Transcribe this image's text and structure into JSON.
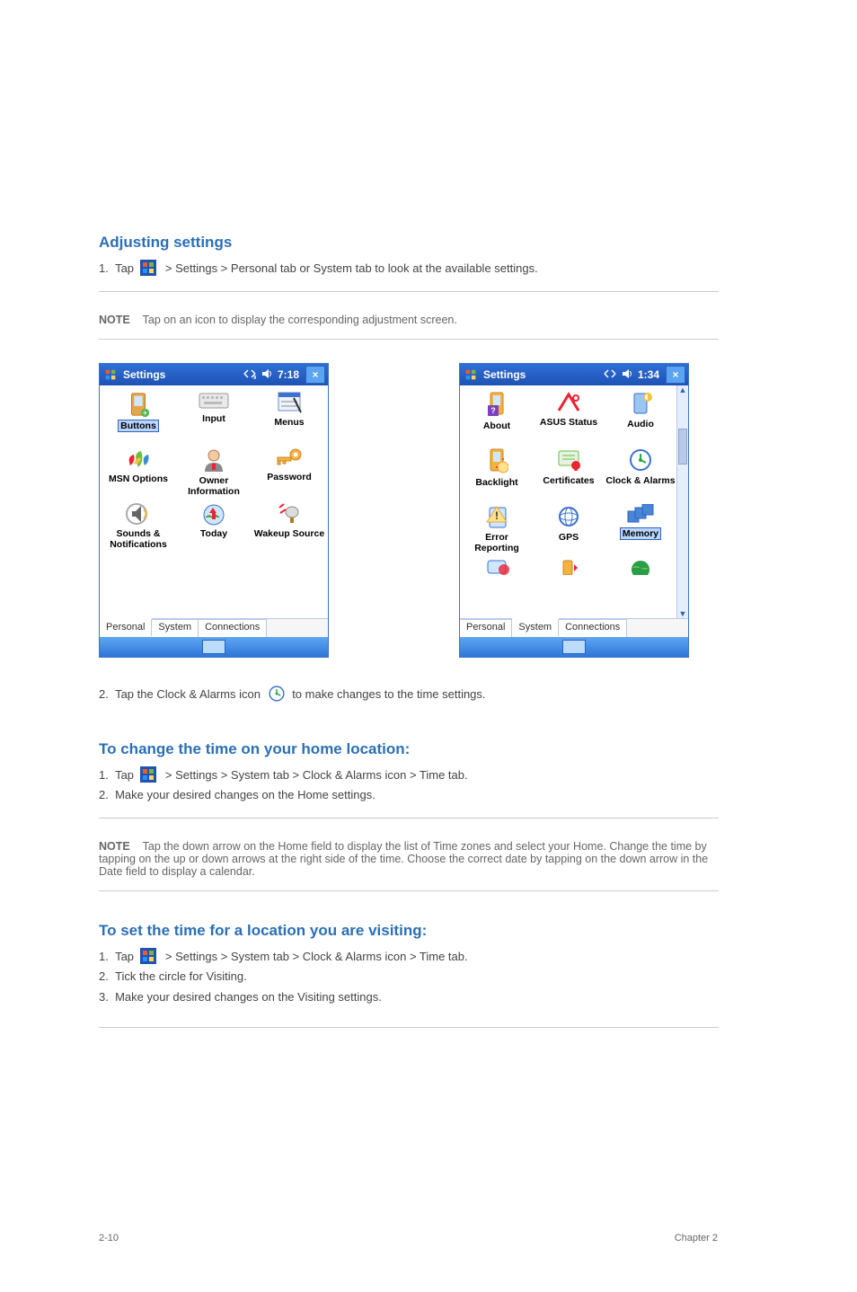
{
  "common": {
    "noteLabel": "NOTE"
  },
  "sections": {
    "adjusting": {
      "title": "Adjusting settings",
      "step1_pre": "Tap",
      "step1_post": "> Settings > Personal tab or System tab to look at the available settings.",
      "note": "Tap on an icon to display the corresponding adjustment screen.",
      "step2_pre": "Tap the Clock & Alarms icon",
      "step2_post": "to make changes to the time settings."
    },
    "home": {
      "title": "To change the time on your home location:",
      "step1_pre": "Tap",
      "step1_post": "> Settings > System tab > Clock & Alarms icon > Time tab.",
      "step2": "Make your desired changes on the Home settings.",
      "note": "Tap the down arrow on the Home field to display the list of Time zones and select your Home. Change the time by tapping on the up or down arrows at the right side of the time. Choose the correct date by tapping on the down arrow in the Date field to display a calendar."
    },
    "visiting": {
      "title": "To set the time for a location you are visiting:",
      "step1_pre": "Tap",
      "step1_post": "> Settings > System tab > Clock & Alarms icon > Time tab.",
      "step2": "Tick the circle for Visiting.",
      "step3": "Make your desired changes on the Visiting settings."
    }
  },
  "left": {
    "title": "Settings",
    "time": "7:18",
    "items": [
      "Buttons",
      "Input",
      "Menus",
      "MSN Options",
      "Owner Information",
      "Password",
      "Sounds & Notifications",
      "Today",
      "Wakeup Source"
    ],
    "tabs": [
      "Personal",
      "System",
      "Connections"
    ]
  },
  "right": {
    "title": "Settings",
    "time": "1:34",
    "items": [
      "About",
      "ASUS Status",
      "Audio",
      "Backlight",
      "Certificates",
      "Clock & Alarms",
      "Error Reporting",
      "GPS",
      "Memory"
    ],
    "tabs": [
      "Personal",
      "System",
      "Connections"
    ]
  },
  "footer": {
    "left": "2-10",
    "right": "Chapter 2"
  }
}
